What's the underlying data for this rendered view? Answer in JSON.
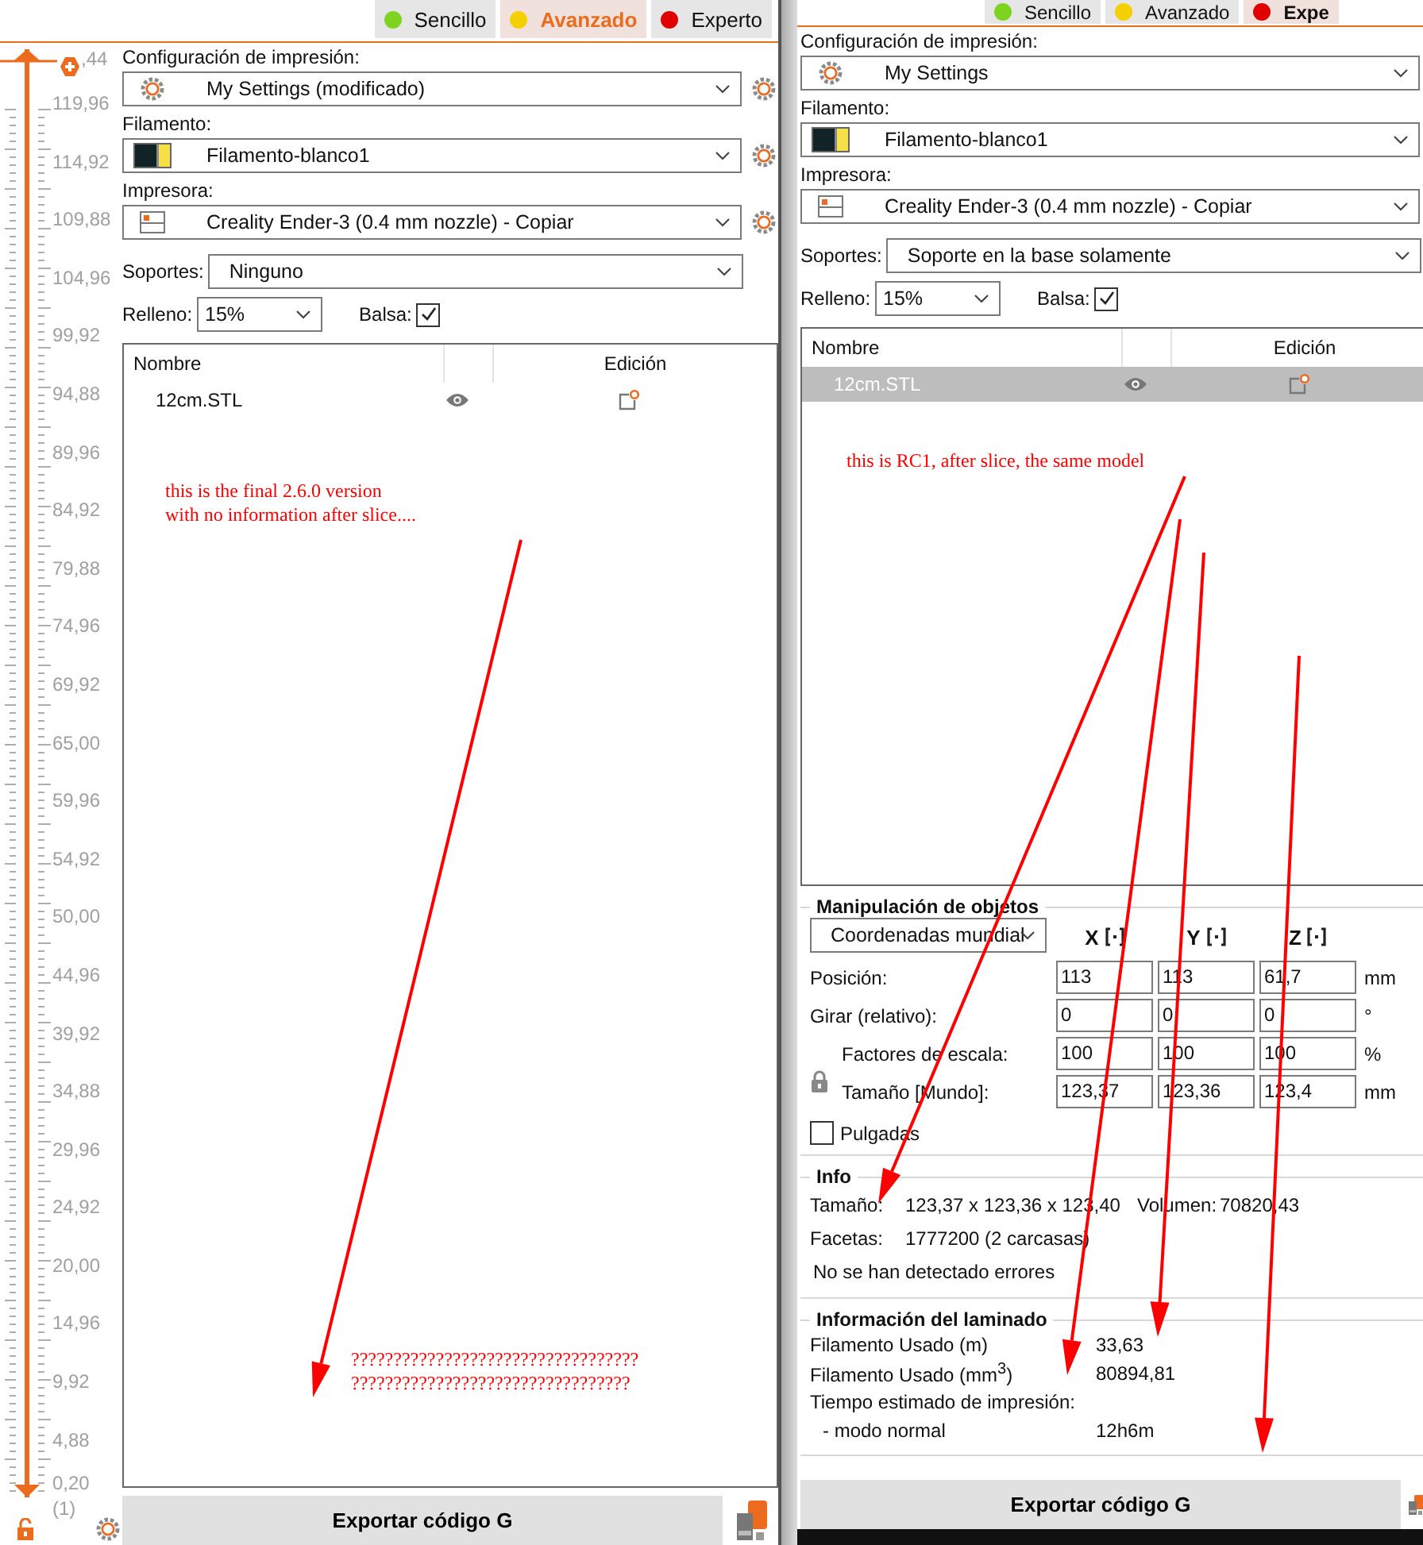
{
  "left_panel": {
    "mode_tabs": [
      {
        "label": "Sencillo",
        "color": "#7ed321",
        "selected": false
      },
      {
        "label": "Avanzado",
        "color": "#f5d000",
        "selected": true
      },
      {
        "label": "Experto",
        "color": "#e00000",
        "selected": false
      }
    ],
    "ruler": {
      "level": 1,
      "top_label": ",44",
      "labels": [
        "119,96",
        "114,92",
        "109,88",
        "104,96",
        "99,92",
        "94,88",
        "89,96",
        "84,92",
        "79,88",
        "74,96",
        "69,92",
        "65,00",
        "59,96",
        "54,92",
        "50,00",
        "44,96",
        "39,92",
        "34,88",
        "29,96",
        "24,92",
        "20,00",
        "14,96",
        "9,92",
        "4,88"
      ],
      "bottom_label": "0,20",
      "layer_count": "(1)"
    },
    "presets": {
      "show_gears": true,
      "print_settings": {
        "label": "Configuración de impresión:",
        "value": "My Settings (modificado)"
      },
      "filament": {
        "label": "Filamento:",
        "value": "Filamento-blanco1"
      },
      "printer": {
        "label": "Impresora:",
        "value": "Creality Ender-3 (0.4 mm nozzle) - Copiar"
      },
      "supports": {
        "label": "Soportes:",
        "value": "Ninguno"
      },
      "infill": {
        "label": "Relleno:",
        "value": "15%"
      },
      "brim": {
        "label": "Balsa:",
        "checked": true
      }
    },
    "object_list": {
      "columns": [
        "Nombre",
        "Edición"
      ],
      "rows": [
        {
          "name": "12cm.STL",
          "selected": false
        }
      ]
    },
    "notes": [
      {
        "lines": [
          "this is the final 2.6.0 version",
          "with no information after slice...."
        ]
      },
      {
        "lines": [
          "??????????????????????????????????",
          "?????????????????????????????????"
        ]
      }
    ],
    "export_button": "Exportar código G"
  },
  "right_panel": {
    "mode_tabs": [
      {
        "label": "Sencillo",
        "color": "#7ed321",
        "selected": false
      },
      {
        "label": "Avanzado",
        "color": "#f5d000",
        "selected": false
      },
      {
        "label": "Expe",
        "color": "#e00000",
        "selected": true
      }
    ],
    "presets": {
      "print_settings": {
        "label": "Configuración de impresión:",
        "value": "My Settings"
      },
      "filament": {
        "label": "Filamento:",
        "value": "Filamento-blanco1"
      },
      "printer": {
        "label": "Impresora:",
        "value": "Creality Ender-3 (0.4 mm nozzle) - Copiar"
      },
      "supports": {
        "label": "Soportes:",
        "value": "Soporte en la base solamente"
      },
      "infill": {
        "label": "Relleno:",
        "value": "15%"
      },
      "brim": {
        "label": "Balsa:",
        "checked": true
      }
    },
    "object_list": {
      "columns": [
        "Nombre",
        "Edición"
      ],
      "rows": [
        {
          "name": "12cm.STL",
          "selected": true
        }
      ]
    },
    "notes": [
      {
        "lines": [
          "this is RC1, after slice, the same model"
        ]
      }
    ],
    "object_manipulation": {
      "title": "Manipulación de objetos",
      "coordinates": "Coordenadas mundial",
      "axes": [
        "X",
        "Y",
        "Z"
      ],
      "rows": [
        {
          "label": "Posición:",
          "values": [
            "113",
            "113",
            "61,7"
          ],
          "unit": "mm"
        },
        {
          "label": "Girar (relativo):",
          "values": [
            "0",
            "0",
            "0"
          ],
          "unit": "°"
        },
        {
          "label": "Factores de escala:",
          "values": [
            "100",
            "100",
            "100"
          ],
          "unit": "%"
        },
        {
          "label": "Tamaño [Mundo]:",
          "values": [
            "123,37",
            "123,36",
            "123,4"
          ],
          "unit": "mm"
        }
      ],
      "inches": {
        "label": "Pulgadas",
        "checked": false
      }
    },
    "info": {
      "title": "Info",
      "size_label": "Tamaño:",
      "size": "123,37 x 123,36 x 123,40",
      "volume_label": "Volumen:",
      "volume": "70820,43",
      "facets_label": "Facetas:",
      "facets": "1777200 (2 carcasas)",
      "status": "No se han detectado errores"
    },
    "slicing_info": {
      "title": "Información del laminado",
      "rows": [
        {
          "kind": "stat",
          "label": "Filamento Usado (m)",
          "value": "33,63"
        },
        {
          "kind": "stat",
          "label": "Filamento Usado (mm$^{3}$)",
          "value": "80894,81"
        },
        {
          "kind": "stat",
          "label": "Tiempo estimado de impresión:"
        },
        {
          "kind": "sub",
          "label": "- modo normal",
          "value": "12h6m"
        }
      ]
    },
    "export_button": "Exportar código G"
  }
}
